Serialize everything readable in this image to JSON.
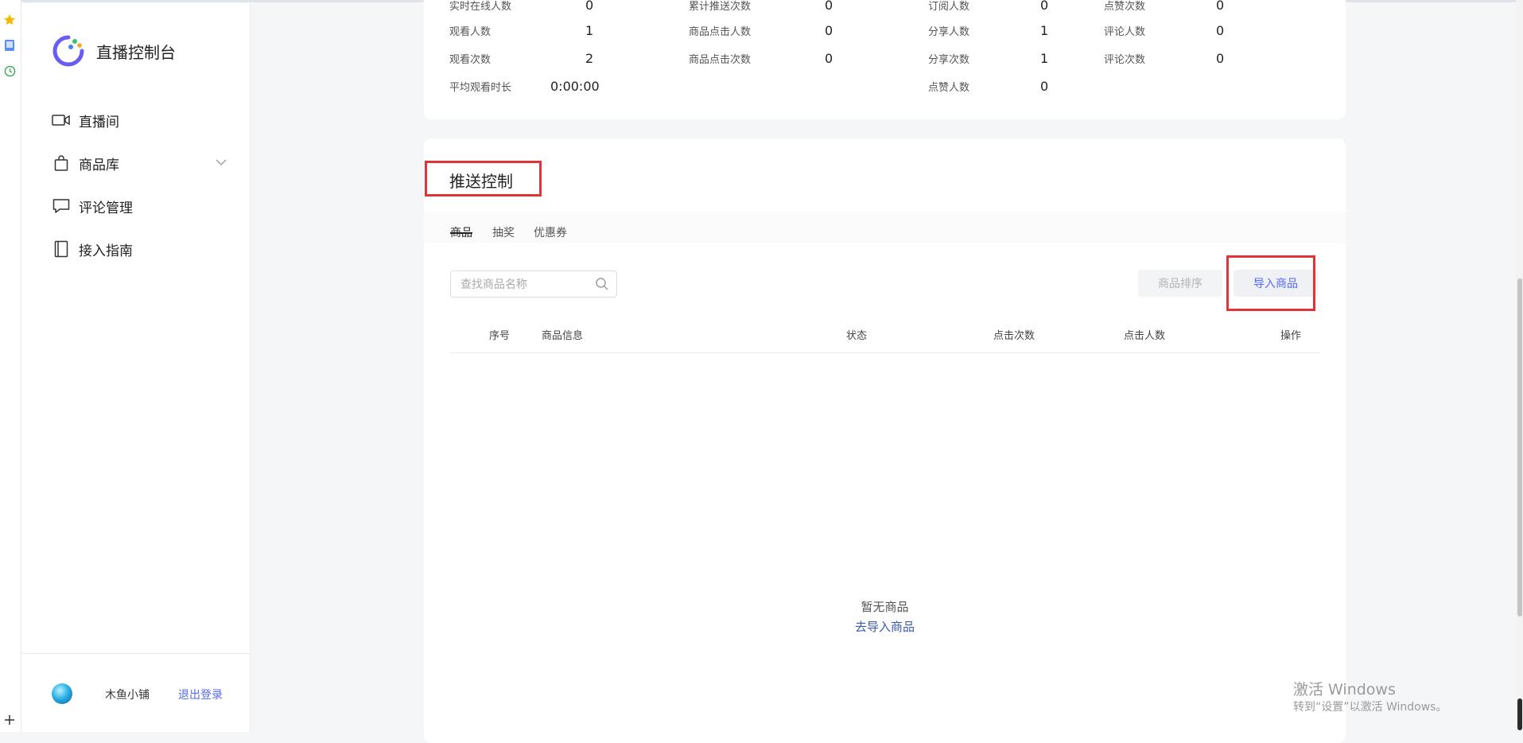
{
  "sidebar": {
    "brand_title": "直播控制台",
    "nav": [
      {
        "label": "直播间"
      },
      {
        "label": "商品库"
      },
      {
        "label": "评论管理"
      },
      {
        "label": "接入指南"
      }
    ],
    "user_name": "木鱼小铺",
    "logout_label": "退出登录"
  },
  "stats": {
    "col1": [
      {
        "label": "实时在线人数",
        "value": "0"
      },
      {
        "label": "观看人数",
        "value": "1"
      },
      {
        "label": "观看次数",
        "value": "2"
      },
      {
        "label": "平均观看时长",
        "value": "0:00:00"
      }
    ],
    "col2": [
      {
        "label": "累计推送次数",
        "value": "0"
      },
      {
        "label": "商品点击人数",
        "value": "0"
      },
      {
        "label": "商品点击次数",
        "value": "0"
      }
    ],
    "col3": [
      {
        "label": "订阅人数",
        "value": "0"
      },
      {
        "label": "分享人数",
        "value": "1"
      },
      {
        "label": "分享次数",
        "value": "1"
      },
      {
        "label": "点赞人数",
        "value": "0"
      }
    ],
    "col4": [
      {
        "label": "点赞次数",
        "value": "0"
      },
      {
        "label": "评论人数",
        "value": "0"
      },
      {
        "label": "评论次数",
        "value": "0"
      }
    ]
  },
  "push": {
    "title": "推送控制",
    "tabs": [
      "商品",
      "抽奖",
      "优惠券"
    ],
    "active_tab": "商品",
    "search_placeholder": "查找商品名称",
    "sort_label": "商品排序",
    "import_label": "导入商品",
    "columns": [
      "序号",
      "商品信息",
      "状态",
      "点击次数",
      "点击人数",
      "操作"
    ],
    "empty_text": "暂无商品",
    "empty_link": "去导入商品"
  },
  "watermark": {
    "line1": "激活 Windows",
    "line2": "转到“设置”以激活 Windows。"
  },
  "colors": {
    "accent": "#5468ff",
    "highlight": "#e0343a",
    "link": "#3a5aa8"
  }
}
